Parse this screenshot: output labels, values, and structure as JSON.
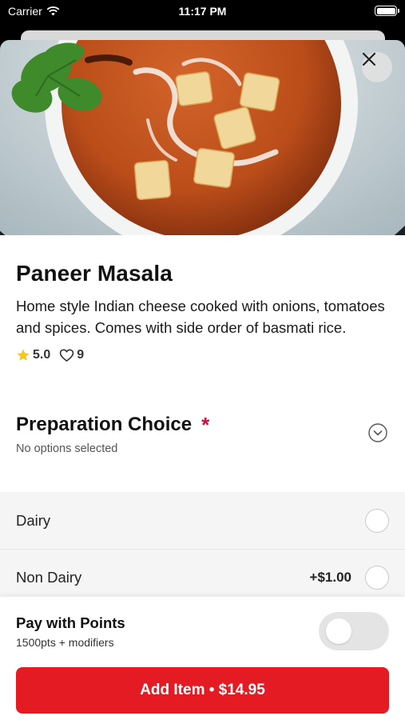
{
  "status_bar": {
    "carrier": "Carrier",
    "time": "11:17 PM"
  },
  "item": {
    "title": "Paneer Masala",
    "description": "Home style Indian cheese cooked with onions, tomatoes and spices. Comes with side order of basmati rice.",
    "rating": "5.0",
    "likes": "9"
  },
  "preparation": {
    "title": "Preparation Choice",
    "required_marker": "*",
    "subtitle": "No options selected",
    "options": [
      {
        "name": "Dairy",
        "price": ""
      },
      {
        "name": "Non Dairy",
        "price": "+$1.00"
      }
    ]
  },
  "points": {
    "title": "Pay with Points",
    "subtitle": "1500pts + modifiers",
    "enabled": false
  },
  "add_button": {
    "label": "Add Item • $14.95"
  },
  "colors": {
    "accent_red": "#e51b23",
    "required_red": "#c8103e",
    "star_yellow": "#f5c518"
  }
}
